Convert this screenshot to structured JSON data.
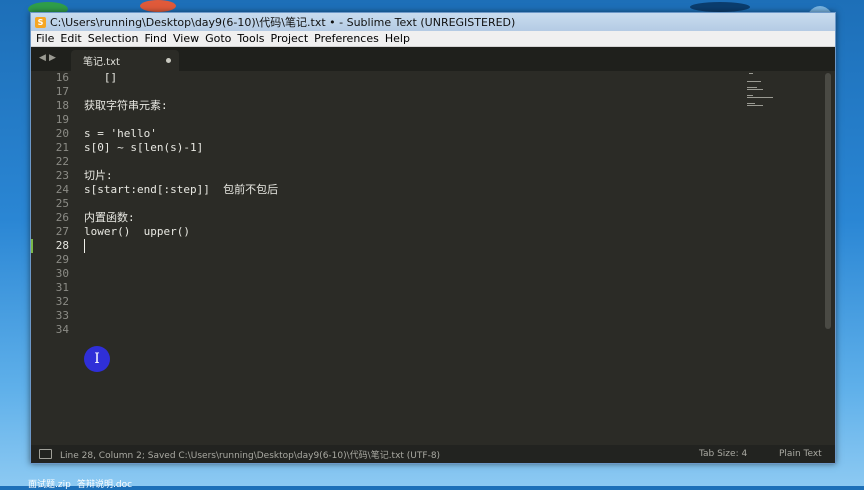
{
  "window": {
    "title": "C:\\Users\\running\\Desktop\\day9(6-10)\\代码\\笔记.txt • - Sublime Text (UNREGISTERED)",
    "app_icon_glyph": "S"
  },
  "menu": [
    "File",
    "Edit",
    "Selection",
    "Find",
    "View",
    "Goto",
    "Tools",
    "Project",
    "Preferences",
    "Help"
  ],
  "tabs": {
    "nav_left": "◀",
    "nav_right": "▶",
    "active": {
      "label": "笔记.txt",
      "dirty": true
    }
  },
  "editor": {
    "current_line": 28,
    "gutter": [
      "16",
      "17",
      "18",
      "19",
      "20",
      "21",
      "22",
      "23",
      "24",
      "25",
      "26",
      "27",
      "28",
      "29",
      "30",
      "31",
      "32",
      "33",
      "34"
    ],
    "lines": [
      "   []",
      "",
      "获取字符串元素:",
      "",
      "s = 'hello'",
      "s[0] ~ s[len(s)-1]",
      "",
      "切片:",
      "s[start:end[:step]]  包前不包后",
      "",
      "内置函数:",
      "lower()  upper()",
      "",
      "",
      "",
      "",
      "",
      "",
      ""
    ]
  },
  "status": {
    "text": "Line 28, Column 2; Saved C:\\Users\\running\\Desktop\\day9(6-10)\\代码\\笔记.txt (UTF-8)",
    "tab_size": "Tab Size: 4",
    "syntax": "Plain Text"
  },
  "cursor_badge": {
    "glyph": "I"
  },
  "desktop": {
    "icon_labels": [
      "面试题.zip",
      "答辩说明.doc"
    ]
  },
  "colors": {
    "editor_bg": "#2b2b26",
    "current_line_marker": "#7ab84a",
    "badge": "#2f2fd8"
  }
}
